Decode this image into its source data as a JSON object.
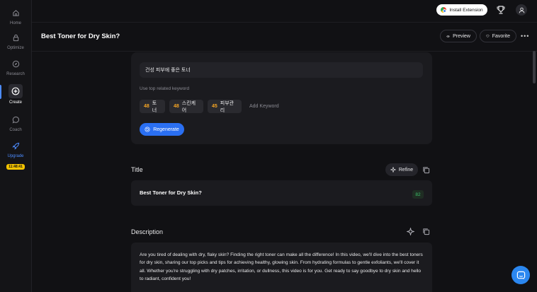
{
  "sidebar": {
    "items": [
      {
        "label": "Home",
        "icon": "home-icon"
      },
      {
        "label": "Optimize",
        "icon": "lock-icon"
      },
      {
        "label": "Research",
        "icon": "compass-icon"
      },
      {
        "label": "Create",
        "icon": "plus-circle-icon"
      },
      {
        "label": "Coach",
        "icon": "chat-icon"
      },
      {
        "label": "Upgrade",
        "icon": "rocket-icon"
      }
    ],
    "timer": "11:48:41"
  },
  "topbar": {
    "install_label": "Install Extension"
  },
  "header": {
    "title": "Best Toner for Dry Skin?",
    "preview_label": "Preview",
    "favorite_label": "Favorite"
  },
  "keywords": {
    "input_value": "건성 피부에 좋은 토너",
    "hint": "Use top related keyword",
    "chips": [
      {
        "score": "48",
        "word": "토너"
      },
      {
        "score": "48",
        "word": "스킨케어"
      },
      {
        "score": "45",
        "word": "피부관리"
      }
    ],
    "add_label": "Add Keyword",
    "regenerate_label": "Regenerate"
  },
  "title_section": {
    "label": "Title",
    "refine_label": "Refine",
    "value": "Best Toner for Dry Skin?",
    "score": "82"
  },
  "description_section": {
    "label": "Description",
    "text": "Are you tired of dealing with dry, flaky skin? Finding the right toner can make all the difference! In this video, we'll dive into the best toners for dry skin, sharing our top picks and tips for achieving healthy, glowing skin. From hydrating formulas to gentle exfoliants, we'll cover it all. Whether you're struggling with dry patches, irritation, or dullness, this video is for you. Get ready to say goodbye to dry skin and hello to radiant, confident you!"
  },
  "colors": {
    "accent": "#2a6ff2",
    "score_orange": "#f5a524",
    "score_green": "#3cc46b",
    "background": "#111114",
    "card": "#1b1b1f"
  }
}
